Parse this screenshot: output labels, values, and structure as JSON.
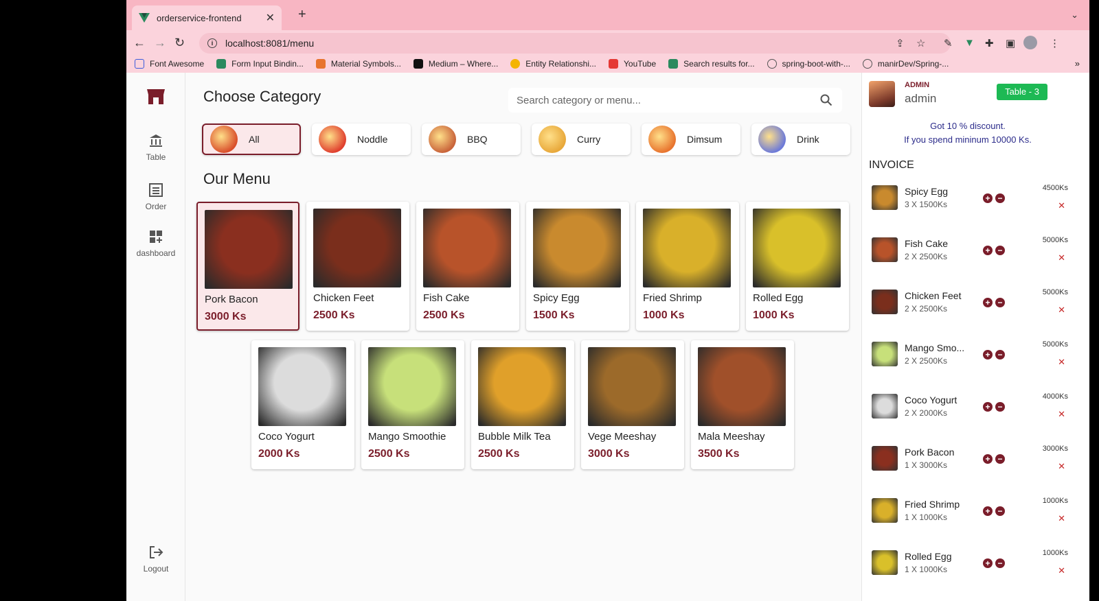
{
  "browser": {
    "tab_title": "orderservice-frontend",
    "url": "localhost:8081/menu",
    "bookmarks": [
      "Font Awesome",
      "Form Input Bindin...",
      "Material Symbols...",
      "Medium – Where...",
      "Entity Relationshi...",
      "YouTube",
      "Search results for...",
      "spring-boot-with-...",
      "manirDev/Spring-..."
    ]
  },
  "sidebar": {
    "items": [
      {
        "label": "Table",
        "icon": "bank-icon"
      },
      {
        "label": "Order",
        "icon": "list-icon"
      },
      {
        "label": "dashboard",
        "icon": "dashboard-icon"
      }
    ],
    "logout": "Logout"
  },
  "main": {
    "title": "Choose Category",
    "search_placeholder": "Search category or menu...",
    "categories": [
      {
        "label": "All",
        "active": true,
        "color": "#d94f2b"
      },
      {
        "label": "Noddle",
        "active": false,
        "color": "#e0402e"
      },
      {
        "label": "BBQ",
        "active": false,
        "color": "#c9643a"
      },
      {
        "label": "Curry",
        "active": false,
        "color": "#e8a83a"
      },
      {
        "label": "Dimsum",
        "active": false,
        "color": "#e8742e"
      },
      {
        "label": "Drink",
        "active": false,
        "color": "#6d7ad8"
      }
    ],
    "menu_title": "Our Menu",
    "menu": [
      {
        "name": "Pork Bacon",
        "price": "3000 Ks",
        "active": true,
        "color": "#8a2f1f"
      },
      {
        "name": "Chicken Feet",
        "price": "2500 Ks",
        "active": false,
        "color": "#7a2e1c"
      },
      {
        "name": "Fish Cake",
        "price": "2500 Ks",
        "active": false,
        "color": "#b8532a"
      },
      {
        "name": "Spicy Egg",
        "price": "1500 Ks",
        "active": false,
        "color": "#c98a2e"
      },
      {
        "name": "Fried Shrimp",
        "price": "1000 Ks",
        "active": false,
        "color": "#d9b02a"
      },
      {
        "name": "Rolled Egg",
        "price": "1000 Ks",
        "active": false,
        "color": "#d9c02a"
      },
      {
        "name": "Coco Yogurt",
        "price": "2000 Ks",
        "active": false,
        "color": "#dcdcdc"
      },
      {
        "name": "Mango Smoothie",
        "price": "2500 Ks",
        "active": false,
        "color": "#c7e07a"
      },
      {
        "name": "Bubble Milk Tea",
        "price": "2500 Ks",
        "active": false,
        "color": "#e0a02a"
      },
      {
        "name": "Vege Meeshay",
        "price": "3000 Ks",
        "active": false,
        "color": "#9c6a2a"
      },
      {
        "name": "Mala Meeshay",
        "price": "3500 Ks",
        "active": false,
        "color": "#a0502a"
      }
    ]
  },
  "invoice": {
    "role": "ADMIN",
    "username": "admin",
    "table": "Table - 3",
    "discount_line1": "Got 10 % discount.",
    "discount_line2": "If you spend mininum 10000 Ks.",
    "title": "INVOICE",
    "items": [
      {
        "name": "Spicy Egg",
        "qty": "3 X 1500Ks",
        "total": "4500Ks",
        "color": "#c98a2e"
      },
      {
        "name": "Fish Cake",
        "qty": "2 X 2500Ks",
        "total": "5000Ks",
        "color": "#b8532a"
      },
      {
        "name": "Chicken Feet",
        "qty": "2 X 2500Ks",
        "total": "5000Ks",
        "color": "#7a2e1c"
      },
      {
        "name": "Mango Smo...",
        "qty": "2 X 2500Ks",
        "total": "5000Ks",
        "color": "#c7e07a"
      },
      {
        "name": "Coco Yogurt",
        "qty": "2 X 2000Ks",
        "total": "4000Ks",
        "color": "#dcdcdc"
      },
      {
        "name": "Pork Bacon",
        "qty": "1 X 3000Ks",
        "total": "3000Ks",
        "color": "#8a2f1f"
      },
      {
        "name": "Fried Shrimp",
        "qty": "1 X 1000Ks",
        "total": "1000Ks",
        "color": "#d9b02a"
      },
      {
        "name": "Rolled Egg",
        "qty": "1 X 1000Ks",
        "total": "1000Ks",
        "color": "#d9c02a"
      }
    ]
  }
}
